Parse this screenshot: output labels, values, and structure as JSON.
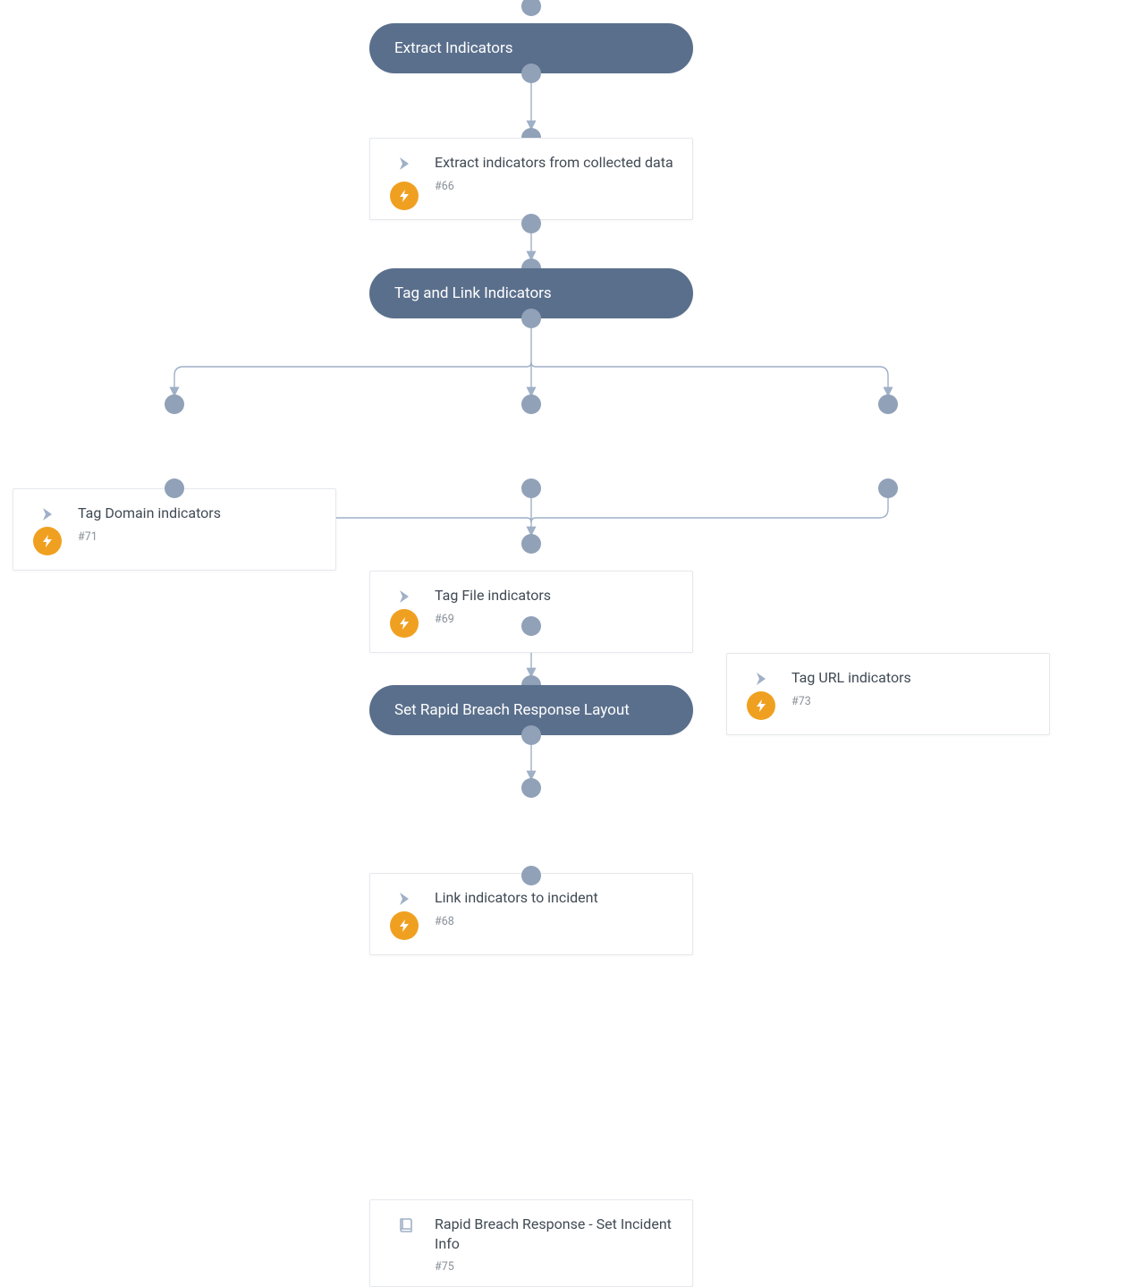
{
  "sections": {
    "s1": {
      "title": "Extract Indicators"
    },
    "s2": {
      "title": "Tag and Link Indicators"
    },
    "s3": {
      "title": "Set Rapid Breach Response Layout"
    }
  },
  "cards": {
    "c66": {
      "title": "Extract indicators from collected data",
      "hash": "#66",
      "icon": "chevron",
      "badge": "bolt"
    },
    "c71": {
      "title": "Tag Domain indicators",
      "hash": "#71",
      "icon": "chevron",
      "badge": "bolt"
    },
    "c69": {
      "title": "Tag File indicators",
      "hash": "#69",
      "icon": "chevron",
      "badge": "bolt"
    },
    "c73": {
      "title": "Tag URL indicators",
      "hash": "#73",
      "icon": "chevron",
      "badge": "bolt"
    },
    "c68": {
      "title": "Link indicators to incident",
      "hash": "#68",
      "icon": "chevron",
      "badge": "bolt"
    },
    "c75": {
      "title": "Rapid Breach Response - Set Incident Info",
      "hash": "#75",
      "icon": "book",
      "badge": "none"
    }
  }
}
